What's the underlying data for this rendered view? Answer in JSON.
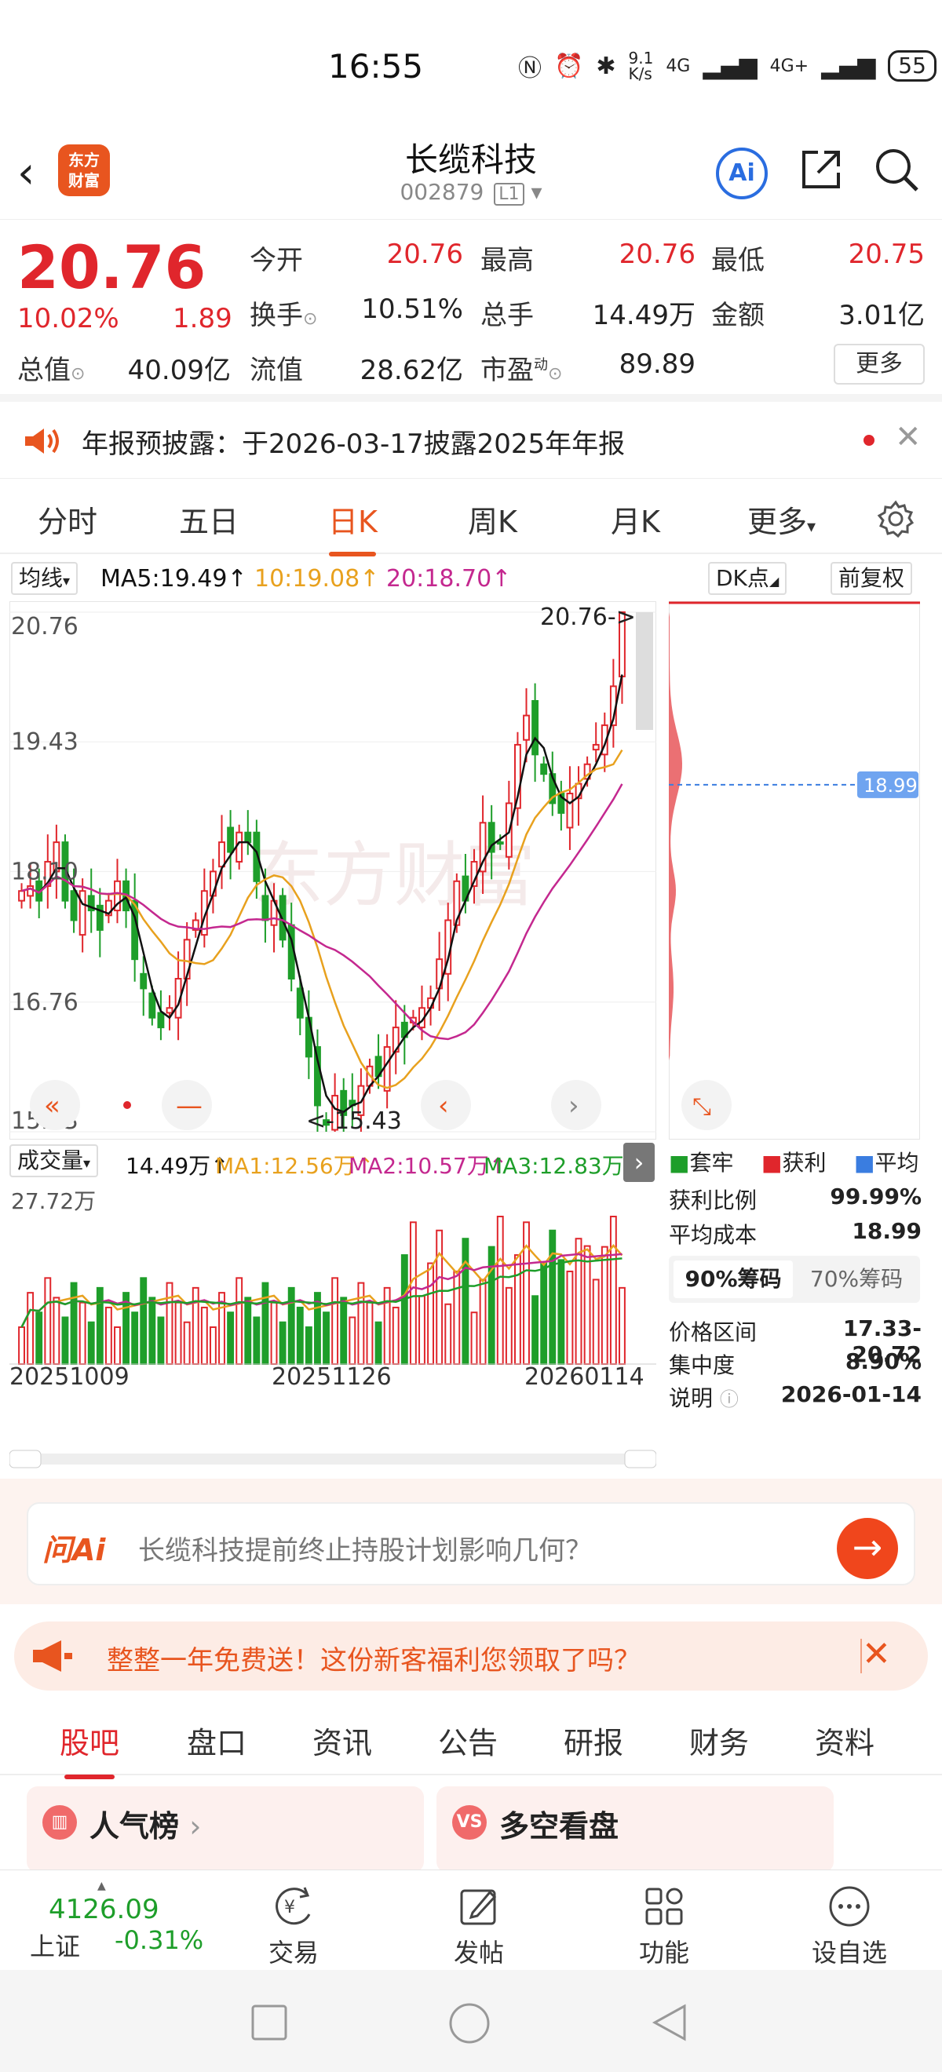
{
  "status": {
    "time": "16:55",
    "net": "9.1\nK/s",
    "sig1": "4G",
    "sig2": "4G+",
    "battery": "55"
  },
  "header": {
    "title": "长缆科技",
    "code": "002879",
    "level": "L1",
    "logo": "东方\n财富",
    "ai": "Ai"
  },
  "quote": {
    "price": "20.76",
    "pct": "10.02%",
    "chg": "1.89",
    "open_l": "今开",
    "open_v": "20.76",
    "high_l": "最高",
    "high_v": "20.76",
    "low_l": "最低",
    "low_v": "20.75",
    "turn_l": "换手",
    "turn_v": "10.51%",
    "vol_l": "总手",
    "vol_v": "14.49万",
    "amt_l": "金额",
    "amt_v": "3.01亿",
    "mcap_l": "总值",
    "mcap_v": "40.09亿",
    "float_l": "流值",
    "float_v": "28.62亿",
    "pe_l": "市盈",
    "pe_sup": "动",
    "pe_v": "89.89",
    "more": "更多"
  },
  "notice": {
    "text": "年报预披露：于2026-03-17披露2025年年报"
  },
  "ktabs": [
    "分时",
    "五日",
    "日K",
    "周K",
    "月K",
    "更多"
  ],
  "ma": {
    "sel": "均线",
    "ma5": "MA5:19.49↑",
    "ma10": "10:19.08↑",
    "ma20": "20:18.70↑",
    "dk": "DK点",
    "adj": "前复权"
  },
  "chart_data": {
    "type": "candlestick",
    "ylim": [
      15.43,
      20.76
    ],
    "yticks": [
      "20.76",
      "19.43",
      "18.10",
      "16.76",
      "15.43"
    ],
    "max_label": "20.76->",
    "min_label": "<-15.43",
    "avg_cost": "18.99",
    "x_labels": [
      "20251009",
      "20251126",
      "20260114"
    ],
    "closes": [
      17.9,
      17.95,
      17.8,
      18.2,
      18.4,
      17.8,
      17.6,
      17.9,
      17.7,
      17.5,
      17.8,
      18.0,
      17.7,
      17.2,
      16.9,
      16.6,
      16.5,
      16.7,
      17.0,
      17.4,
      17.6,
      17.9,
      18.1,
      18.4,
      18.3,
      18.5,
      18.4,
      18.0,
      17.6,
      17.8,
      17.4,
      17.0,
      16.6,
      16.2,
      15.7,
      15.5,
      15.8,
      15.6,
      15.7,
      15.9,
      16.1,
      16.0,
      16.3,
      16.5,
      16.4,
      16.6,
      16.7,
      16.8,
      17.2,
      17.6,
      18.0,
      17.8,
      18.2,
      18.6,
      18.3,
      18.4,
      18.8,
      19.4,
      19.7,
      19.3,
      19.1,
      18.8,
      18.7,
      18.9,
      19.0,
      19.2,
      19.4,
      19.6,
      20.0,
      20.76
    ]
  },
  "volume": {
    "sel": "成交量",
    "v": "14.49万↑",
    "ma1": "MA1:12.56万↑",
    "ma2": "MA2:10.57万↑",
    "ma3": "MA3:12.83万↓",
    "max": "27.72万"
  },
  "chips": {
    "legend": [
      "套牢",
      "获利",
      "平均"
    ],
    "profit_l": "获利比例",
    "profit_v": "99.99%",
    "avg_l": "平均成本",
    "avg_v": "18.99",
    "tab1": "90%筹码",
    "tab2": "70%筹码",
    "range_l": "价格区间",
    "range_v": "17.33-20.72",
    "conc_l": "集中度",
    "conc_v": "8.90%",
    "desc_l": "说明",
    "desc_v": "2026-01-14"
  },
  "askai": {
    "logo": "问Ai",
    "text": "长缆科技提前终止持股计划影响几何？"
  },
  "promo": {
    "text": "整整一年免费送！这份新客福利您领取了吗？"
  },
  "btabs": [
    "股吧",
    "盘口",
    "资讯",
    "公告",
    "研报",
    "财务",
    "资料"
  ],
  "cards": {
    "left": "人气榜",
    "right": "多空看盘"
  },
  "bnav": {
    "index_v": "4126.09",
    "index_l": "上证",
    "index_c": "-0.31%",
    "trade": "交易",
    "post": "发帖",
    "func": "功能",
    "watch": "设自选"
  },
  "colors": {
    "up": "#e0262c",
    "down": "#1e9e2a",
    "accent": "#e8551f",
    "ma5": "#111111",
    "ma10": "#e8a11e",
    "ma20": "#c4288f"
  }
}
